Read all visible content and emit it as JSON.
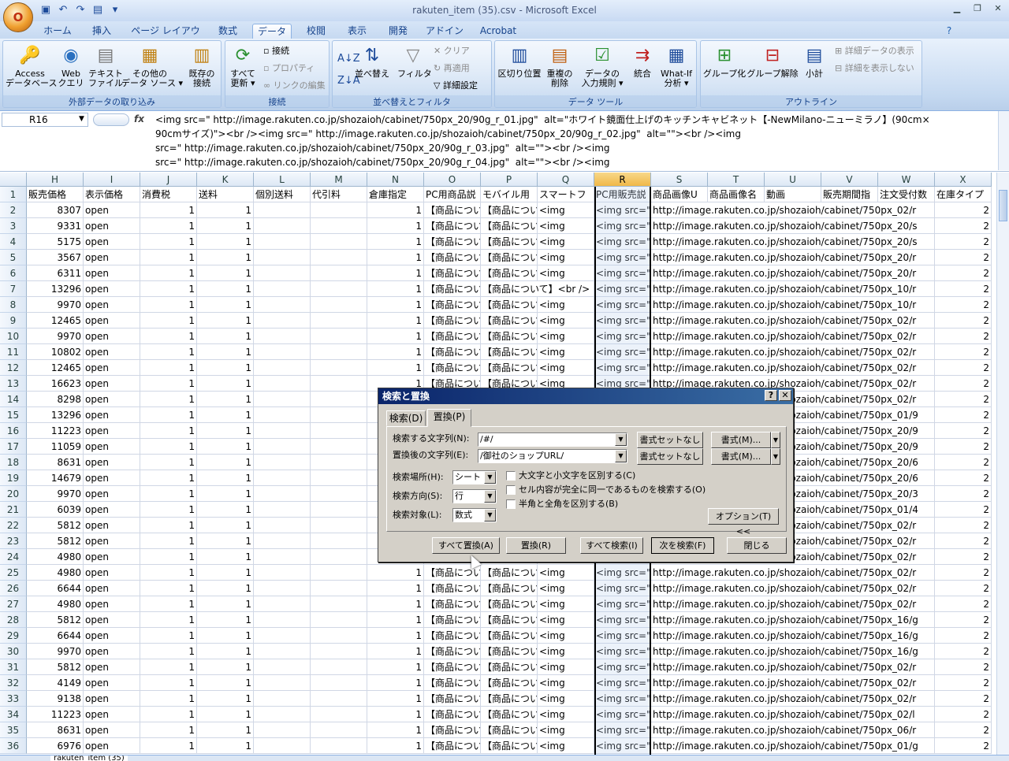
{
  "window": {
    "title": "rakuten_item (35).csv - Microsoft Excel"
  },
  "office_button": {
    "label": "O"
  },
  "tabs": [
    {
      "label": "ホーム"
    },
    {
      "label": "挿入"
    },
    {
      "label": "ページ レイアウト"
    },
    {
      "label": "数式"
    },
    {
      "label": "データ"
    },
    {
      "label": "校閲"
    },
    {
      "label": "表示"
    },
    {
      "label": "開発"
    },
    {
      "label": "アドイン"
    },
    {
      "label": "Acrobat"
    }
  ],
  "ribbon": {
    "groups": {
      "external": "外部データの取り込み",
      "connect": "接続",
      "sort": "並べ替えとフィルタ",
      "tools": "データ ツール",
      "outline": "アウトライン"
    },
    "buttons": {
      "access": "Access\nデータベース",
      "web": "Web\nクエリ",
      "text": "テキスト\nファイル",
      "other": "その他の\nデータ ソース ▾",
      "existing": "既存の\n接続",
      "refresh": "すべて\n更新 ▾",
      "connections": "接続",
      "properties": "プロパティ",
      "edit_links": "リンクの編集",
      "sort": "並べ替え",
      "filter": "フィルタ",
      "clear": "クリア",
      "reapply": "再適用",
      "advanced": "詳細設定",
      "text_to_cols": "区切り位置",
      "remove_dup": "重複の\n削除",
      "validation": "データの\n入力規則 ▾",
      "consolidate": "統合",
      "whatif": "What-If\n分析 ▾",
      "group": "グループ化",
      "ungroup": "グループ解除",
      "subtotal": "小計",
      "show_detail": "詳細データの表示",
      "hide_detail": "詳細を表示しない"
    }
  },
  "formula_bar": {
    "name_box": "R16",
    "fx": "fx",
    "content": "<img src=\" http://image.rakuten.co.jp/shozaioh/cabinet/750px_20/90g_r_01.jpg\"  alt=\"ホワイト鏡面仕上げのキッチンキャビネット【-NewMilano-ニューミラノ】(90cm×\n90cmサイズ)\"><br /><img src=\" http://image.rakuten.co.jp/shozaioh/cabinet/750px_20/90g_r_02.jpg\"  alt=\"\"><br /><img\nsrc=\" http://image.rakuten.co.jp/shozaioh/cabinet/750px_20/90g_r_03.jpg\"  alt=\"\"><br /><img\nsrc=\" http://image.rakuten.co.jp/shozaioh/cabinet/750px_20/90g_r_04.jpg\"  alt=\"\"><br /><img"
  },
  "columns": [
    "H",
    "I",
    "J",
    "K",
    "L",
    "M",
    "N",
    "O",
    "P",
    "Q",
    "R",
    "S",
    "T",
    "U",
    "V",
    "W",
    "X"
  ],
  "header_row": [
    "販売価格",
    "表示価格",
    "消費税",
    "送料",
    "個別送料",
    "代引料",
    "倉庫指定",
    "PC用商品説",
    "モバイル用",
    "スマートフ",
    "PC用販売説",
    "商品画像U",
    "商品画像名",
    "動画",
    "販売期間指",
    "注文受付数",
    "在庫タイプ"
  ],
  "rows": [
    {
      "n": "2",
      "price": "8307",
      "u": "//image.rakuten.co.jp/shozaioh/cabinet/750px_02/r"
    },
    {
      "n": "3",
      "price": "9331",
      "u": "//image.rakuten.co.jp/shozaioh/cabinet/750px_20/s"
    },
    {
      "n": "4",
      "price": "5175",
      "u": "//image.rakuten.co.jp/shozaioh/cabinet/750px_20/s"
    },
    {
      "n": "5",
      "price": "3567",
      "u": "//image.rakuten.co.jp/shozaioh/cabinet/750px_20/r"
    },
    {
      "n": "6",
      "price": "6311",
      "u": "//image.rakuten.co.jp/shozaioh/cabinet/750px_20/r"
    },
    {
      "n": "7",
      "price": "13296",
      "u": "//image.rakuten.co.jp/shozaioh/cabinet/750px_10/r",
      "p": "【商品について】<br />"
    },
    {
      "n": "8",
      "price": "9970",
      "u": "//image.rakuten.co.jp/shozaioh/cabinet/750px_10/r"
    },
    {
      "n": "9",
      "price": "12465",
      "u": "//image.rakuten.co.jp/shozaioh/cabinet/750px_02/r"
    },
    {
      "n": "10",
      "price": "9970",
      "u": "//image.rakuten.co.jp/shozaioh/cabinet/750px_02/r"
    },
    {
      "n": "11",
      "price": "10802",
      "u": "//image.rakuten.co.jp/shozaioh/cabinet/750px_02/r"
    },
    {
      "n": "12",
      "price": "12465",
      "u": "//image.rakuten.co.jp/shozaioh/cabinet/750px_02/r"
    },
    {
      "n": "13",
      "price": "16623",
      "u": "//image.rakuten.co.jp/shozaioh/cabinet/750px_02/r"
    },
    {
      "n": "14",
      "price": "8298",
      "u": "//image.rakuten.co.jp/shozaioh/cabinet/750px_02/r"
    },
    {
      "n": "15",
      "price": "13296",
      "u": "//image.rakuten.co.jp/shozaioh/cabinet/750px_01/9"
    },
    {
      "n": "16",
      "price": "11223",
      "u": "//image.rakuten.co.jp/shozaioh/cabinet/750px_20/9"
    },
    {
      "n": "17",
      "price": "11059",
      "u": "//image.rakuten.co.jp/shozaioh/cabinet/750px_20/9"
    },
    {
      "n": "18",
      "price": "8631",
      "u": "//image.rakuten.co.jp/shozaioh/cabinet/750px_20/6"
    },
    {
      "n": "19",
      "price": "14679",
      "u": "//image.rakuten.co.jp/shozaioh/cabinet/750px_20/6"
    },
    {
      "n": "20",
      "price": "9970",
      "u": "//image.rakuten.co.jp/shozaioh/cabinet/750px_20/3"
    },
    {
      "n": "21",
      "price": "6039",
      "u": "//image.rakuten.co.jp/shozaioh/cabinet/750px_01/4"
    },
    {
      "n": "22",
      "price": "5812",
      "u": "//image.rakuten.co.jp/shozaioh/cabinet/750px_02/r"
    },
    {
      "n": "23",
      "price": "5812",
      "u": "//image.rakuten.co.jp/shozaioh/cabinet/750px_02/r"
    },
    {
      "n": "24",
      "price": "4980",
      "u": "//image.rakuten.co.jp/shozaioh/cabinet/750px_02/r"
    },
    {
      "n": "25",
      "price": "4980",
      "u": "//image.rakuten.co.jp/shozaioh/cabinet/750px_02/r"
    },
    {
      "n": "26",
      "price": "6644",
      "u": "//image.rakuten.co.jp/shozaioh/cabinet/750px_02/r"
    },
    {
      "n": "27",
      "price": "4980",
      "u": "//image.rakuten.co.jp/shozaioh/cabinet/750px_02/r"
    },
    {
      "n": "28",
      "price": "5812",
      "u": "//image.rakuten.co.jp/shozaioh/cabinet/750px_16/g"
    },
    {
      "n": "29",
      "price": "6644",
      "u": "//image.rakuten.co.jp/shozaioh/cabinet/750px_16/g"
    },
    {
      "n": "30",
      "price": "9970",
      "u": "//image.rakuten.co.jp/shozaioh/cabinet/750px_16/g"
    },
    {
      "n": "31",
      "price": "5812",
      "u": "//image.rakuten.co.jp/shozaioh/cabinet/750px_02/r"
    },
    {
      "n": "32",
      "price": "4149",
      "u": "//image.rakuten.co.jp/shozaioh/cabinet/750px_02/r"
    },
    {
      "n": "33",
      "price": "9138",
      "u": "//image.rakuten.co.jp/shozaioh/cabinet/750px_02/r"
    },
    {
      "n": "34",
      "price": "11223",
      "u": "//image.rakuten.co.jp/shozaioh/cabinet/750px_02/l"
    },
    {
      "n": "35",
      "price": "8631",
      "u": "//image.rakuten.co.jp/shozaioh/cabinet/750px_06/r"
    },
    {
      "n": "36",
      "price": "6976",
      "u": "//image.rakuten.co.jp/shozaioh/cabinet/750px_01/g"
    }
  ],
  "cell_common": {
    "display_price": "open",
    "tax": "1",
    "shipping": "1",
    "warehouse": "1",
    "o": "【商品につい",
    "p": "【商品につい",
    "q": "<img",
    "r": "<img src=\"",
    "s_prefix": "http:",
    "x": "2",
    "row1": "1"
  },
  "sheet_tab": "rakuten_item (35)",
  "dialog": {
    "title": "検索と置換",
    "help": "?",
    "close": "✕",
    "tab_find": "検索(D)",
    "tab_replace": "置換(P)",
    "find_label": "検索する文字列(N):",
    "find_value": "/#/",
    "replace_label": "置換後の文字列(E):",
    "replace_value": "/御社のショップURL/",
    "no_format": "書式セットなし",
    "format_btn": "書式(M)...",
    "within_label": "検索場所(H):",
    "within_value": "シート",
    "search_label": "検索方向(S):",
    "search_value": "行",
    "lookin_label": "検索対象(L):",
    "lookin_value": "数式",
    "match_case": "大文字と小文字を区別する(C)",
    "match_entire": "セル内容が完全に同一であるものを検索する(O)",
    "match_byte": "半角と全角を区別する(B)",
    "options": "オプション(T) <<",
    "replace_all": "すべて置換(A)",
    "replace": "置換(R)",
    "find_all": "すべて検索(I)",
    "find_next": "次を検索(F)",
    "close_btn": "閉じる"
  }
}
